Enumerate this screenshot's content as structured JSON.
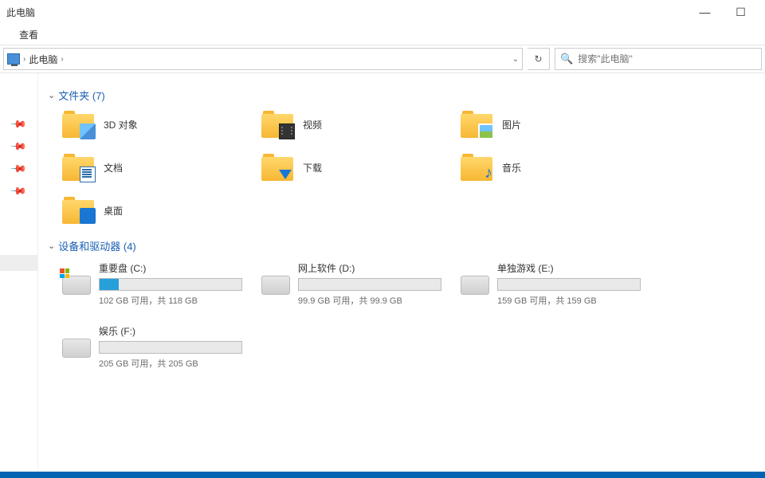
{
  "window": {
    "title": "此电脑",
    "minimize": "—",
    "maximize": "☐"
  },
  "menu": {
    "view": "查看"
  },
  "breadcrumb": {
    "root": "此电脑",
    "sep": "›"
  },
  "search": {
    "placeholder": "搜索\"此电脑\""
  },
  "sections": {
    "folders": {
      "label": "文件夹",
      "count": 7
    },
    "drives": {
      "label": "设备和驱动器",
      "count": 4
    }
  },
  "folders": [
    {
      "name": "3D 对象",
      "icon": "3d"
    },
    {
      "name": "视频",
      "icon": "video"
    },
    {
      "name": "图片",
      "icon": "pic"
    },
    {
      "name": "文档",
      "icon": "doc"
    },
    {
      "name": "下载",
      "icon": "dl"
    },
    {
      "name": "音乐",
      "icon": "music"
    },
    {
      "name": "桌面",
      "icon": "desk"
    }
  ],
  "drives": [
    {
      "name": "重要盘 (C:)",
      "free": 102,
      "total": 118,
      "os": true
    },
    {
      "name": "网上软件 (D:)",
      "free": 99.9,
      "total": 99.9,
      "os": false
    },
    {
      "name": "单独游戏 (E:)",
      "free": 159,
      "total": 159,
      "os": false
    },
    {
      "name": "娱乐 (F:)",
      "free": 205,
      "total": 205,
      "os": false
    }
  ],
  "labels": {
    "free": "GB 可用，共",
    "total_suffix": "GB"
  }
}
